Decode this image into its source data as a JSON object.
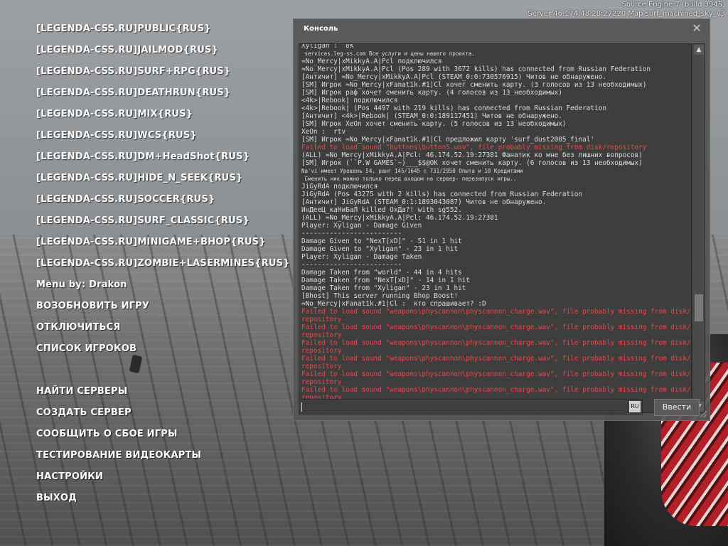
{
  "engine": {
    "line1": "Source Engine 7 (build 3945)",
    "line2": "Server 46.174.48.28:27220 Map surf_machined_sky_v3"
  },
  "menu": {
    "servers": [
      "[LEGENDA-CSS.RU]PUBLIC{RUS}",
      "[LEGENDA-CSS.RU]JAILMOD{RUS}",
      "[LEGENDA-CSS.RU]SURF+RPG{RUS}",
      "[LEGENDA-CSS.RU]DEATHRUN{RUS}",
      "[LEGENDA-CSS.RU]MIX{RUS}",
      "[LEGENDA-CSS.RU]WCS{RUS}",
      "[LEGENDA-CSS.RU]DM+HeadShot{RUS}",
      "[LEGENDA-CSS.RU]HIDE_N_SEEK{RUS}",
      "[LEGENDA-CSS.RU]SOCCER{RUS}",
      "[LEGENDA-CSS.RU]SURF_CLASSIC{RUS}",
      "[LEGENDA-CSS.RU]MINIGAME+BHOP{RUS}",
      "[LEGENDA-CSS.RU]ZOMBIE+LASERMINES{RUS}"
    ],
    "credit": "Menu by: Drakon",
    "resume": "ВОЗОБНОВИТЬ ИГРУ",
    "disconnect": "ОТКЛЮЧИТЬСЯ",
    "players": "СПИСОК ИГРОКОВ",
    "find_servers": "НАЙТИ СЕРВЕРЫ",
    "create_server": "СОЗДАТЬ СЕРВЕР",
    "report": "СООБЩИТЬ О СБОЕ ИГРЫ",
    "video_test": "ТЕСТИРОВАНИЕ ВИДЕОКАРТЫ",
    "settings": "НАСТРОЙКИ",
    "exit": "ВЫХОД"
  },
  "console": {
    "title": "Консоль",
    "close": "✕",
    "submit": "Ввести",
    "input_value": "",
    "lang": "RU",
    "lines": [
      {
        "t": "Xyligan :  вк",
        "k": ""
      },
      {
        "t": " services.leg-ss.com Все услуги и цены нашего проекта.",
        "k": "small"
      },
      {
        "t": "≈No_Mercy|xMikkyA.A|Pcl подключился",
        "k": ""
      },
      {
        "t": "≈No_Mercy|xMikkyA.A|Pcl (Pos 289 with 3672 kills) has connected from Russian Federation",
        "k": ""
      },
      {
        "t": "[Античит] ≈No_Mercy|xMikkyA.A|Pcl (STEAM_0:0:730576915) Читов не обнаружено.",
        "k": ""
      },
      {
        "t": "[SM] Игрок ≈No_Mercy|xFanat1k.#1|Cl хочет сменить карту. (3 голосов из 13 необходимых)",
        "k": ""
      },
      {
        "t": "[SM] Игрок раф хочет сменить карту. (4 голосов из 13 необходимых)",
        "k": ""
      },
      {
        "t": "<4k>|Rebook| подключился",
        "k": ""
      },
      {
        "t": "<4k>|Rebook| (Pos 4497 with 219 kills) has connected from Russian Federation",
        "k": ""
      },
      {
        "t": "[Античит] <4k>|Rebook| (STEAM_0:0:189117451) Читов не обнаружено.",
        "k": ""
      },
      {
        "t": "[SM] Игрок XeOn хочет сменить карту. (5 голосов из 13 необходимых)",
        "k": ""
      },
      {
        "t": "XeOn :  rtv",
        "k": ""
      },
      {
        "t": "[SM] Игрок ≈No_Mercy|xFanat1k.#1|Cl предложил карту 'surf_dust2005_final'",
        "k": ""
      },
      {
        "t": "Failed to load sound \"buttons\\button5.wav\", file probably missing from disk/repository",
        "k": "err"
      },
      {
        "t": "(ALL) ≈No_Mercy|xMikkyA.A|Pcl: 46.174.52.19:27381 Фанатик ко мне без лишних вопросов)",
        "k": ""
      },
      {
        "t": "[SM] Игрок (``P.W GAMES`~)___$$@OK хочет сменить карту. (6 голосов из 13 необходимых)",
        "k": ""
      },
      {
        "t": "Na'vi имеет Уровень 54, ранг 145/1645 с 731/2950 Опыта и 10 Кредитами",
        "k": "small"
      },
      {
        "t": " Сменить ник можно только перед входом на сервер- перезапуск игры..",
        "k": "small"
      },
      {
        "t": "JiGyRdA подключился",
        "k": ""
      },
      {
        "t": "JiGyRdA (Pos 43275 with 2 kills) has connected from Russian Federation",
        "k": ""
      },
      {
        "t": "[Античит] JiGyRdA (STEAM_0:1:1893043087) Читов не обнаружено.",
        "k": ""
      },
      {
        "t": "ИнДееЦ_каНиБаЛ killed ОхДа?! with sg552.",
        "k": ""
      },
      {
        "t": "(ALL) ≈No_Mercy|xMikkyA.A|Pcl: 46.174.52.19:27381",
        "k": ""
      },
      {
        "t": "Player: Xyligan - Damage Given",
        "k": ""
      },
      {
        "t": "-------------------------",
        "k": ""
      },
      {
        "t": "Damage Given to \"NexT[xD]\" - 51 in 1 hit",
        "k": ""
      },
      {
        "t": "Damage Given to \"Xyligan\" - 23 in 1 hit",
        "k": ""
      },
      {
        "t": "Player: Xyligan - Damage Taken",
        "k": ""
      },
      {
        "t": "-------------------------",
        "k": ""
      },
      {
        "t": "Damage Taken from \"world\" - 44 in 4 hits",
        "k": ""
      },
      {
        "t": "Damage Taken from \"NexT[xD]\" - 14 in 1 hit",
        "k": ""
      },
      {
        "t": "Damage Taken from \"Xyligan\" - 23 in 1 hit",
        "k": ""
      },
      {
        "t": "[Bhost] This server running Bhop Boost!",
        "k": ""
      },
      {
        "t": "≈No_Mercy|xFanat1k.#1|Cl :  кто спрашивает? :D",
        "k": ""
      },
      {
        "t": "Failed to load sound \"weapons\\physcannon\\physcannon_charge.wav\", file probably missing from disk/repository",
        "k": "err"
      },
      {
        "t": "Failed to load sound \"weapons\\physcannon\\physcannon_charge.wav\", file probably missing from disk/repository",
        "k": "err"
      },
      {
        "t": "Failed to load sound \"weapons\\physcannon\\physcannon_charge.wav\", file probably missing from disk/repository",
        "k": "err"
      },
      {
        "t": "Failed to load sound \"weapons\\physcannon\\physcannon_charge.wav\", file probably missing from disk/repository",
        "k": "err"
      },
      {
        "t": "Failed to load sound \"weapons\\physcannon\\physcannon_charge.wav\", file probably missing from disk/repository",
        "k": "err"
      },
      {
        "t": "Failed to load sound \"weapons\\physcannon\\physcannon_charge.wav\", file probably missing from disk/repository",
        "k": "err"
      }
    ]
  },
  "colors": {
    "error": "#e84848",
    "log_text": "#dcdcdc",
    "menu_text": "#ffffff"
  }
}
